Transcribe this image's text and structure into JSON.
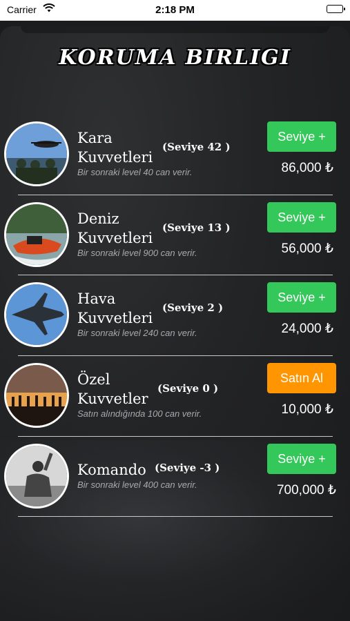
{
  "status_bar": {
    "carrier": "Carrier",
    "time": "2:18 PM"
  },
  "header": {
    "title": "KORUMA BIRLIGI"
  },
  "colors": {
    "upgrade": "#34c759",
    "buy": "#ff9500"
  },
  "units": [
    {
      "name_line1": "Kara",
      "name_line2": "Kuvvetleri",
      "level": "(Seviye 42 )",
      "desc": "Bir sonraki level 40 can verir.",
      "action": "Seviye +",
      "price": "86,000 ₺"
    },
    {
      "name_line1": "Deniz",
      "name_line2": "Kuvvetleri",
      "level": "(Seviye 13 )",
      "desc": "Bir sonraki level 900 can verir.",
      "action": "Seviye +",
      "price": "56,000 ₺"
    },
    {
      "name_line1": "Hava",
      "name_line2": "Kuvvetleri",
      "level": "(Seviye 2 )",
      "desc": "Bir sonraki level 240 can verir.",
      "action": "Seviye +",
      "price": "24,000 ₺"
    },
    {
      "name_line1": "Özel",
      "name_line2": "Kuvvetler",
      "level": "(Seviye 0 )",
      "desc": "Satın alındığında 100 can verir.",
      "action": "Satın Al",
      "price": "10,000 ₺"
    },
    {
      "name_line1": "Komando",
      "name_line2": "",
      "level": "(Seviye -3 )",
      "desc": "Bir sonraki level 400 can verir.",
      "action": "Seviye +",
      "price": "700,000 ₺"
    }
  ]
}
